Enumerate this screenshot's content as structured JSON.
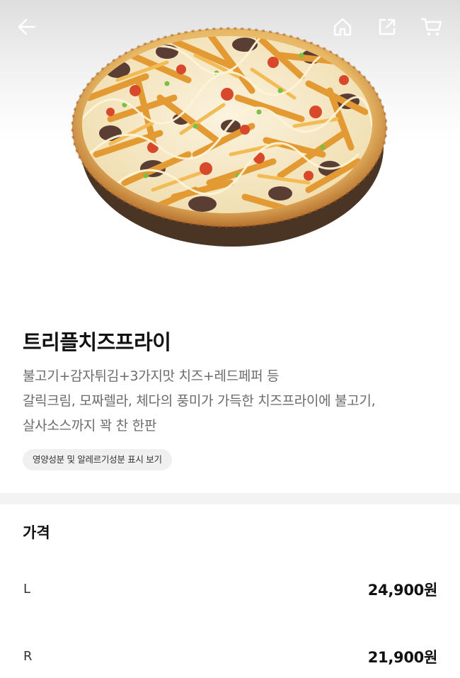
{
  "header": {
    "icons": [
      "back-arrow-icon",
      "home-icon",
      "share-icon",
      "cart-icon"
    ]
  },
  "product": {
    "name": "트리플치즈프라이",
    "description_lines": [
      "불고기+감자튀김+3가지맛 치즈+레드페퍼 등",
      "갈릭크림, 모짜렐라, 체다의 풍미가 가득한 치즈프라이에 불고기,",
      "살사소스까지 꽉 찬 한판"
    ],
    "nutrition_link": "영양성분 및 알레르기성분 표시 보기"
  },
  "price": {
    "heading": "가격",
    "options": [
      {
        "size": "L",
        "price": "24,900원"
      },
      {
        "size": "R",
        "price": "21,900원"
      }
    ]
  },
  "colors": {
    "text_primary": "#111111",
    "text_secondary": "#6b6b6b",
    "chip_bg": "#f0f0f0",
    "divider": "#f3f3f3",
    "header_icon": "#ffffff"
  }
}
